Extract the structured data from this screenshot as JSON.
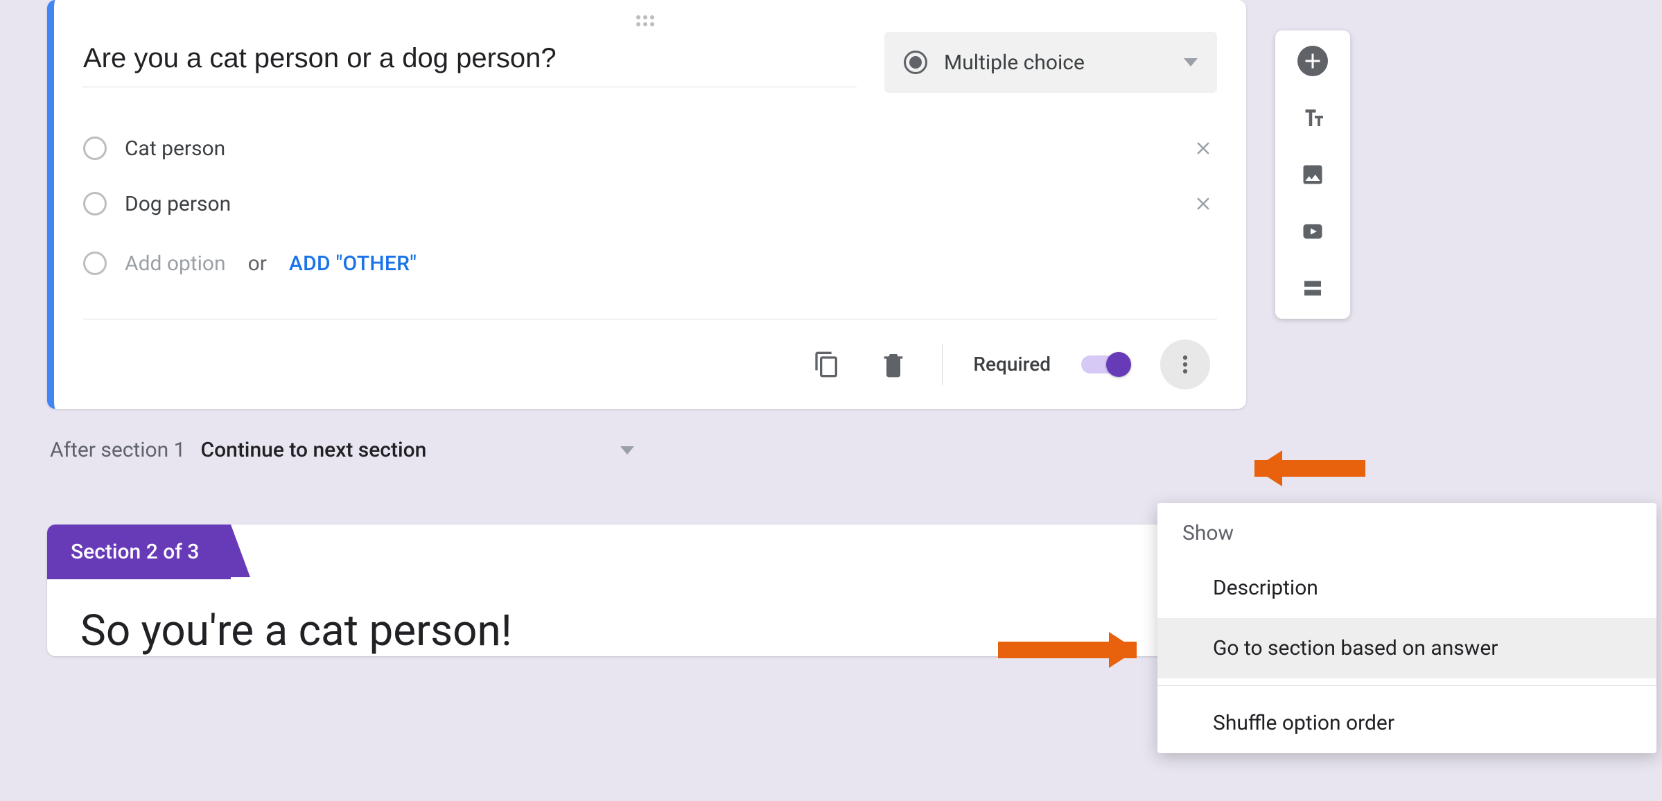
{
  "question": {
    "title": "Are you a cat person or a dog person?",
    "type_label": "Multiple choice",
    "options": [
      "Cat person",
      "Dog person"
    ],
    "add_option_placeholder": "Add option",
    "or_text": "or",
    "add_other_label": "ADD \"OTHER\""
  },
  "footer": {
    "required_label": "Required"
  },
  "after_section": {
    "label": "After section 1",
    "value": "Continue to next section"
  },
  "section2": {
    "tab": "Section 2 of 3",
    "title": "So you're a cat person!"
  },
  "menu": {
    "heading": "Show",
    "item_description": "Description",
    "item_goto": "Go to section based on answer",
    "item_shuffle": "Shuffle option order"
  }
}
